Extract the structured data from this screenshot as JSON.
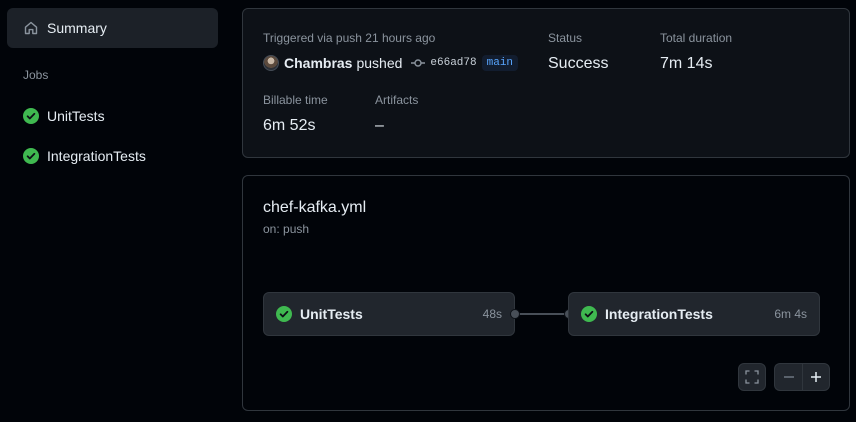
{
  "sidebar": {
    "summary_label": "Summary",
    "jobs_heading": "Jobs",
    "jobs": [
      {
        "label": "UnitTests",
        "status": "success"
      },
      {
        "label": "IntegrationTests",
        "status": "success"
      }
    ]
  },
  "summary": {
    "trigger_text": "Triggered via push 21 hours ago",
    "actor": "Chambras",
    "action": "pushed",
    "commit_sha": "e66ad78",
    "branch": "main",
    "status_label": "Status",
    "status_value": "Success",
    "duration_label": "Total duration",
    "duration_value": "7m 14s",
    "billable_label": "Billable time",
    "billable_value": "6m 52s",
    "artifacts_label": "Artifacts",
    "artifacts_value": "–"
  },
  "workflow": {
    "file": "chef-kafka.yml",
    "trigger": "on: push",
    "jobs": [
      {
        "name": "UnitTests",
        "duration": "48s"
      },
      {
        "name": "IntegrationTests",
        "duration": "6m 4s"
      }
    ]
  },
  "colors": {
    "success": "#3fb950",
    "accent_blue": "#58a6ff"
  }
}
